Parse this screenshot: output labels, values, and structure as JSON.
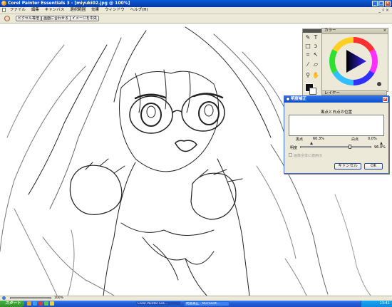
{
  "window": {
    "title": "Corel Painter Essentials 3 - [miyuki02.jpg @ 100%]",
    "controls": [
      "_",
      "□",
      "×"
    ]
  },
  "menu": {
    "items": [
      "ファイル",
      "編集",
      "キャンバス",
      "選択範囲",
      "効果",
      "ウィンドウ",
      "ヘルプ(H)"
    ],
    "right_controls": "_ ♯ ×"
  },
  "propbar": {
    "buttons": [
      "ピクセル等倍",
      "画面に合わせる",
      "イメージを中央"
    ]
  },
  "toolbox": {
    "tools": [
      "brush",
      "text",
      "rect-select",
      "lasso",
      "crop",
      "transform",
      "dropper",
      "eraser",
      "magnifier",
      "hand"
    ]
  },
  "panels": {
    "color_title": "カラー",
    "layer_title": "レイヤー"
  },
  "dialog": {
    "title": "明度補正",
    "caption": "黒点と白点の位置",
    "black_label": "黒点",
    "black_value": "60.3%",
    "white_label": "白点",
    "white_value": "0.0%",
    "brightness_label": "明度",
    "brightness_value": "96.0%",
    "checkbox_label": "画像全体に適用(I)",
    "cancel": "キャンセル",
    "ok": "OK"
  },
  "status": {
    "zoom": "100%"
  },
  "taskbar": {
    "start": "スタート",
    "tasks": [
      "Corel Painter Ess...",
      "明度補正 - Microsoft..."
    ],
    "clock": "13:41"
  },
  "colors": {
    "xp_blue": "#0a5ad8",
    "panel_bg": "#ece9d8",
    "start_green": "#3a9c33"
  }
}
